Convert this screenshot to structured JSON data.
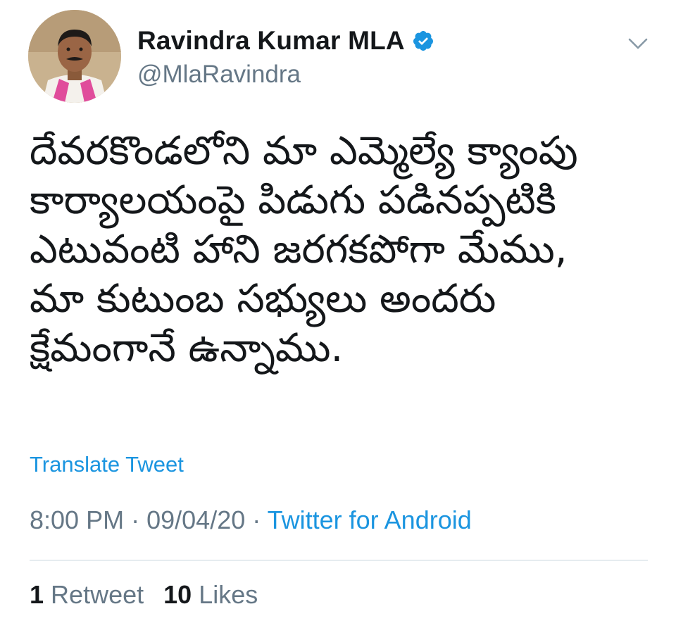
{
  "tweet": {
    "author": {
      "display_name": "Ravindra Kumar MLA",
      "handle": "@MlaRavindra",
      "verified": true,
      "verified_color": "#1b95e0"
    },
    "text": "దేవరకొండలోని మా ఎమ్మెల్యే క్యాంపు\nకార్యాలయంపై పిడుగు పడినప్పటికి\nఎటువంటి హాని జరగకపోగా మేము,\nమా కుటుంబ సభ్యులు అందరు\nక్షేమంగానే ఉన్నాము.",
    "translate_label": "Translate Tweet",
    "time": "8:00 PM",
    "date": "09/04/20",
    "separator": "·",
    "source": "Twitter for Android",
    "retweets": {
      "count": "1",
      "label": "Retweet"
    },
    "likes": {
      "count": "10",
      "label": "Likes"
    }
  },
  "colors": {
    "link": "#1b95e0",
    "secondary_text": "#657786",
    "primary_text": "#14171a",
    "divider": "#e6ecf0"
  },
  "icons": {
    "verified": "verified-badge-icon",
    "menu": "chevron-down-icon"
  }
}
